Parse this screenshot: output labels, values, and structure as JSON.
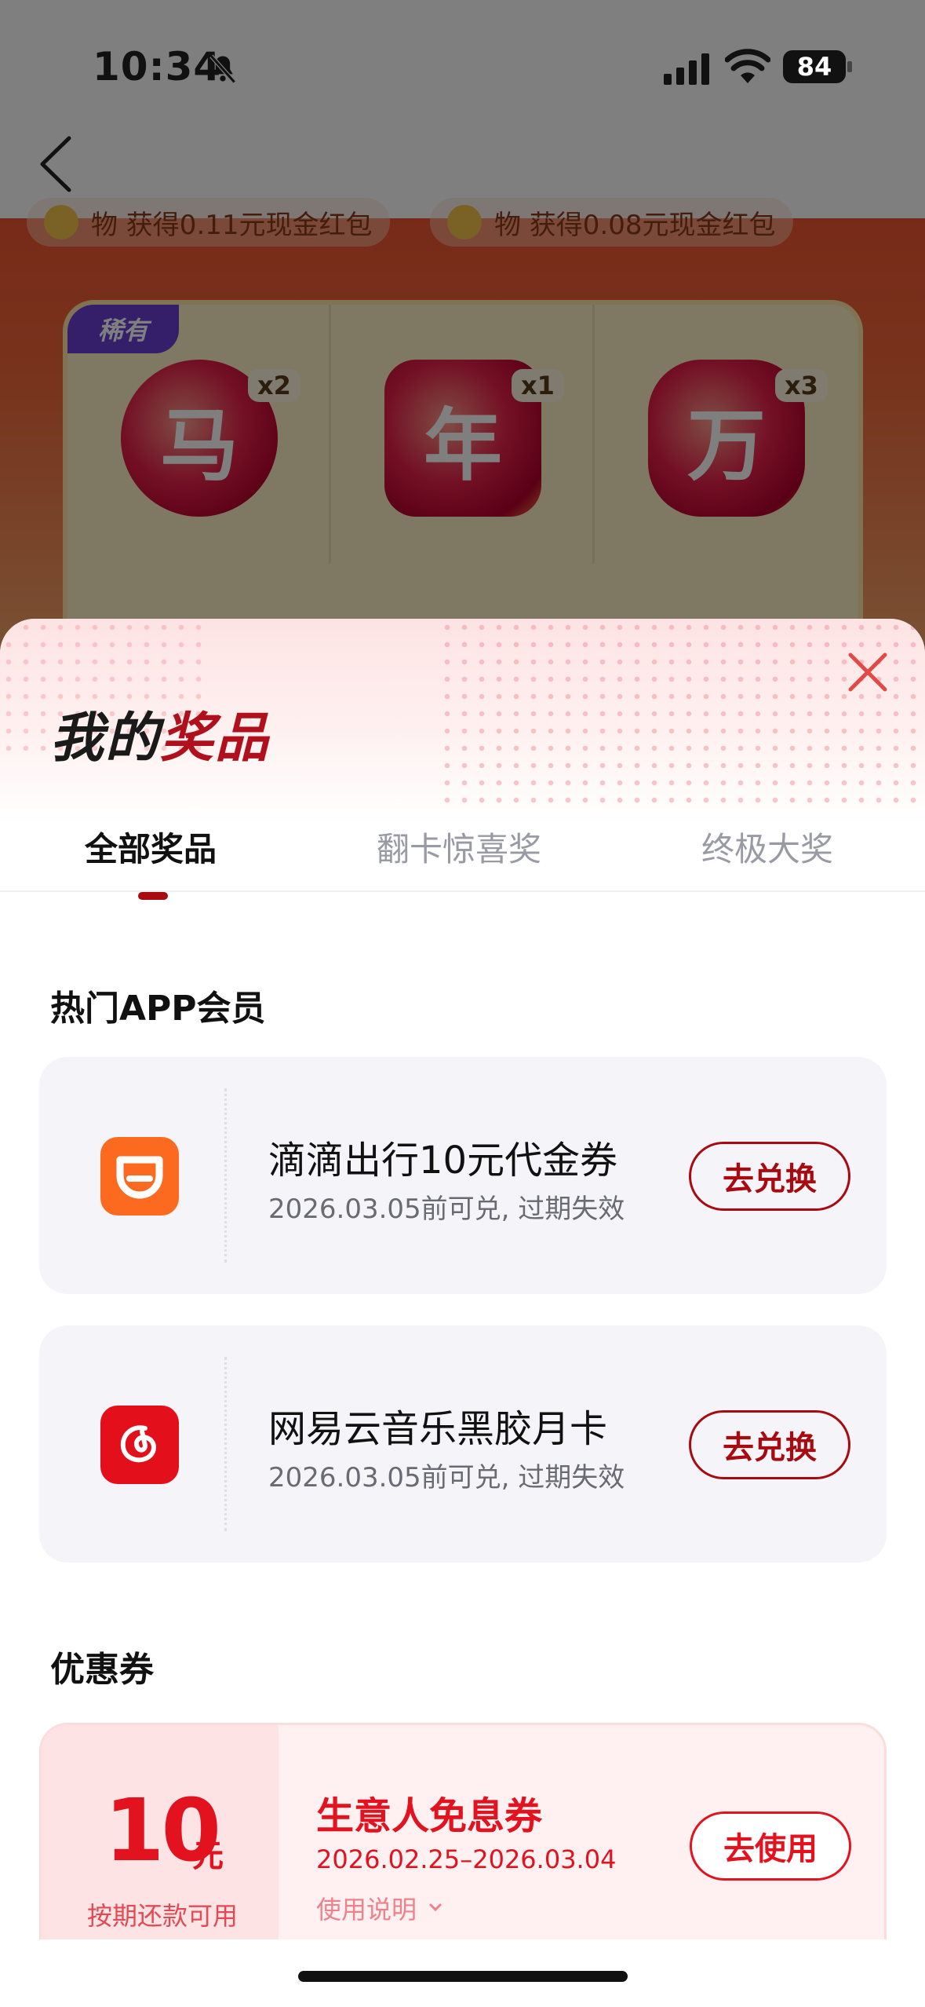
{
  "status_bar": {
    "time": "10:34",
    "battery": "84"
  },
  "background": {
    "ticker": [
      "物 获得0.11元现金红包",
      "物 获得0.08元现金红包"
    ],
    "rare_badge": "稀有",
    "cards": [
      {
        "char": "马",
        "count": "x2"
      },
      {
        "char": "年",
        "count": "x1"
      },
      {
        "char": "万",
        "count": "x3"
      }
    ]
  },
  "sheet": {
    "title_black": "我的",
    "title_red": "奖品",
    "tabs": [
      {
        "label": "全部奖品",
        "active": true
      },
      {
        "label": "翻卡惊喜奖",
        "active": false
      },
      {
        "label": "终极大奖",
        "active": false
      }
    ],
    "section_app": "热门APP会员",
    "prizes": [
      {
        "name": "滴滴出行10元代金券",
        "sub": "2026.03.05前可兑, 过期失效",
        "button": "去兑换",
        "icon": "didi-icon",
        "icon_color": "#fc6a1f"
      },
      {
        "name": "网易云音乐黑胶月卡",
        "sub": "2026.03.05前可兑, 过期失效",
        "button": "去兑换",
        "icon": "netease-music-icon",
        "icon_color": "#e3101b"
      }
    ],
    "section_coupon": "优惠券",
    "coupon": {
      "amount": "10",
      "unit": "元",
      "condition": "按期还款可用",
      "name": "生意人免息券",
      "date": "2026.02.25–2026.03.04",
      "rule": "使用说明",
      "button": "去使用"
    }
  },
  "colors": {
    "accent": "#a80a10",
    "coupon_red": "#e2121f"
  }
}
